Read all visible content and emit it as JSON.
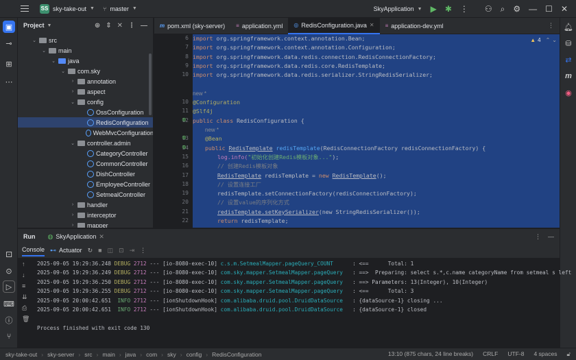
{
  "titlebar": {
    "project_badge": "SS",
    "project_name": "sky-take-out",
    "branch": "master",
    "run_config": "SkyApplication"
  },
  "project_panel": {
    "title": "Project",
    "tree": [
      {
        "label": "src",
        "kind": "folder"
      },
      {
        "label": "main",
        "kind": "folder"
      },
      {
        "label": "java",
        "kind": "folder-blue"
      },
      {
        "label": "com.sky",
        "kind": "folder"
      },
      {
        "label": "annotation",
        "kind": "folder"
      },
      {
        "label": "aspect",
        "kind": "folder"
      },
      {
        "label": "config",
        "kind": "folder"
      },
      {
        "label": "OssConfiguration",
        "kind": "class"
      },
      {
        "label": "RedisConfiguration",
        "kind": "class"
      },
      {
        "label": "WebMvcConfiguration",
        "kind": "class"
      },
      {
        "label": "controller.admin",
        "kind": "folder"
      },
      {
        "label": "CategoryController",
        "kind": "class"
      },
      {
        "label": "CommonController",
        "kind": "class"
      },
      {
        "label": "DishController",
        "kind": "class"
      },
      {
        "label": "EmployeeController",
        "kind": "class"
      },
      {
        "label": "SetmealController",
        "kind": "class"
      },
      {
        "label": "handler",
        "kind": "folder"
      },
      {
        "label": "interceptor",
        "kind": "folder"
      },
      {
        "label": "mapper",
        "kind": "folder"
      }
    ]
  },
  "tabs": [
    {
      "label": "pom.xml (sky-server)",
      "icon": "m"
    },
    {
      "label": "application.yml",
      "icon": "yml"
    },
    {
      "label": "RedisConfiguration.java",
      "icon": "class"
    },
    {
      "label": "application-dev.yml",
      "icon": "yml"
    }
  ],
  "editor": {
    "warning_count": "4",
    "line_numbers": [
      "6",
      "7",
      "8",
      "9",
      "10",
      "",
      "",
      "10",
      "11",
      "12",
      "",
      "13",
      "14",
      "15",
      "16",
      "17",
      "18",
      "19",
      "20",
      "21",
      "22"
    ],
    "lines": {
      "l1": "import org.springframework.context.annotation.Bean;",
      "l2": "import org.springframework.context.annotation.Configuration;",
      "l3": "import org.springframework.data.redis.connection.RedisConnectionFactory;",
      "l4": "import org.springframework.data.redis.core.RedisTemplate;",
      "l5": "import org.springframework.data.redis.serializer.StringRedisSerializer;",
      "hint1": "new *",
      "l7": "@Configuration",
      "l8": "@Slf4j",
      "l9a": "public class ",
      "l9b": "RedisConfiguration {",
      "hint2": "new *",
      "l10": "@Bean",
      "l11a": "public ",
      "l11b": "RedisTemplate",
      "l11c": "redisTemplate",
      "l11d": "(RedisConnectionFactory redisConnectionFactory) {",
      "l12a": "log.info(",
      "l12b": "\"初始化创建Redis模板对象...\"",
      "l12c": ");",
      "l13": "// 创建Redis模板对象",
      "l14a": "RedisTemplate",
      "l14b": " redisTemplate = ",
      "l14c": "new ",
      "l14d": "RedisTemplate",
      "l14e": "();",
      "l15": "// 设置连接工厂",
      "l16": "redisTemplate.setConnectionFactory(redisConnectionFactory);",
      "l17": "// 设置value的序列化方式",
      "l18a": "redisTemplate.setKeySerializer",
      "l18b": "(new StringRedisSerializer());",
      "l19a": "return ",
      "l19b": "redisTemplate;"
    }
  },
  "run_panel": {
    "title": "Run",
    "run_tab": "SkyApplication",
    "console_tab": "Console",
    "actuator_tab": "Actuator",
    "logs": [
      {
        "ts": "2025-09-05 19:29:36.248",
        "lvl": "DEBUG",
        "pid": "2712",
        "thread": "--- [io-8080-exec-10]",
        "cat": "c.s.m.SetmealMapper.pageQuery_COUNT     ",
        "msg": ": <==      Total: 1"
      },
      {
        "ts": "2025-09-05 19:29:36.249",
        "lvl": "DEBUG",
        "pid": "2712",
        "thread": "--- [io-8080-exec-10]",
        "cat": "com.sky.mapper.SetmealMapper.pageQuery  ",
        "msg": ": ==>  Preparing: select s.*,c.name categoryName from setmeal s left"
      },
      {
        "ts": "2025-09-05 19:29:36.250",
        "lvl": "DEBUG",
        "pid": "2712",
        "thread": "--- [io-8080-exec-10]",
        "cat": "com.sky.mapper.SetmealMapper.pageQuery  ",
        "msg": ": ==> Parameters: 13(Integer), 10(Integer)"
      },
      {
        "ts": "2025-09-05 19:29:36.255",
        "lvl": "DEBUG",
        "pid": "2712",
        "thread": "--- [io-8080-exec-10]",
        "cat": "com.sky.mapper.SetmealMapper.pageQuery  ",
        "msg": ": <==      Total: 3"
      },
      {
        "ts": "2025-09-05 20:00:42.651",
        "lvl": " INFO",
        "pid": "2712",
        "thread": "--- [ionShutdownHook]",
        "cat": "com.alibaba.druid.pool.DruidDataSource  ",
        "msg": ": {dataSource-1} closing ..."
      },
      {
        "ts": "2025-09-05 20:00:42.651",
        "lvl": " INFO",
        "pid": "2712",
        "thread": "--- [ionShutdownHook]",
        "cat": "com.alibaba.druid.pool.DruidDataSource  ",
        "msg": ": {dataSource-1} closed"
      }
    ],
    "exit_message": "Process finished with exit code 130"
  },
  "statusbar": {
    "breadcrumbs": [
      "sky-take-out",
      "sky-server",
      "src",
      "main",
      "java",
      "com",
      "sky",
      "config",
      "RedisConfiguration"
    ],
    "position": "13:10 (875 chars, 24 line breaks)",
    "line_sep": "CRLF",
    "encoding": "UTF-8",
    "indent": "4 spaces"
  }
}
